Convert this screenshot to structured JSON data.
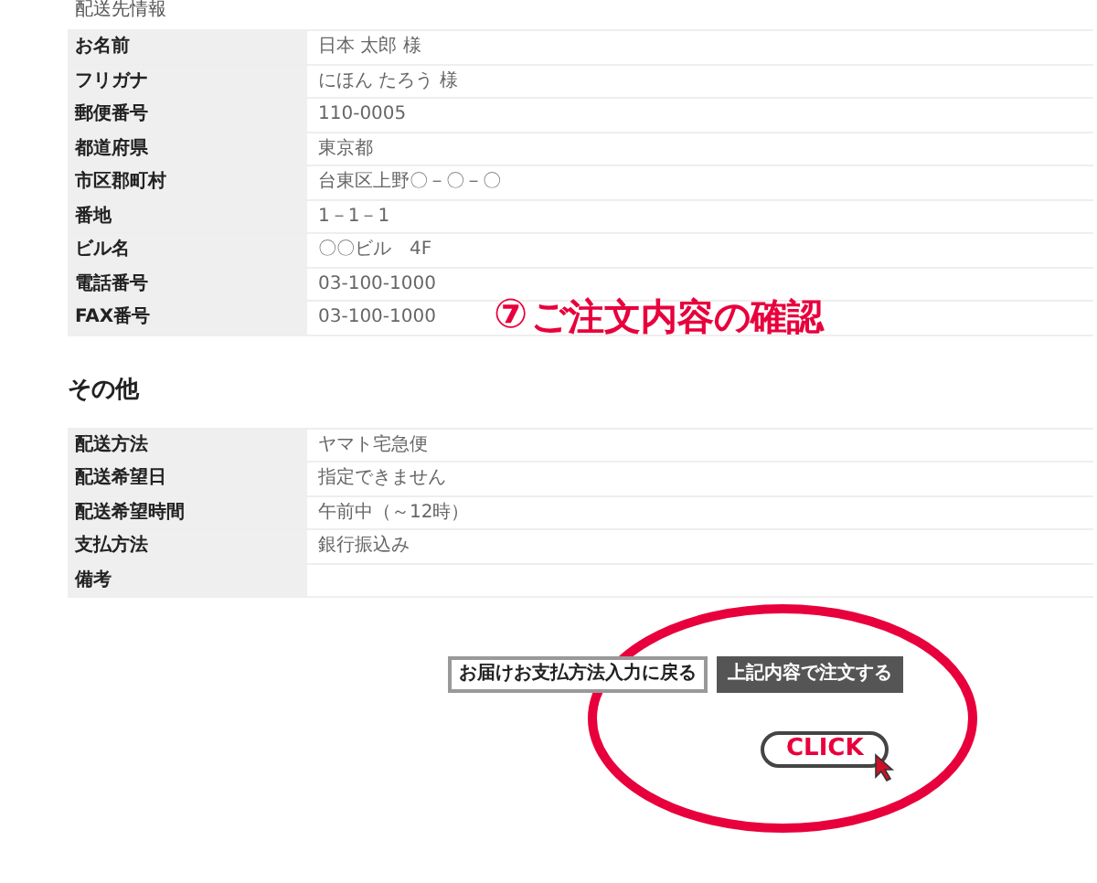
{
  "sections": [
    {
      "title": "配送先情報",
      "rows": [
        {
          "label": "お名前",
          "value": "日本 太郎 様"
        },
        {
          "label": "フリガナ",
          "value": "にほん たろう 様"
        },
        {
          "label": "郵便番号",
          "value": "110-0005"
        },
        {
          "label": "都道府県",
          "value": "東京都"
        },
        {
          "label": "市区郡町村",
          "value": "台東区上野〇－〇－〇"
        },
        {
          "label": "番地",
          "value": "1－1－1"
        },
        {
          "label": "ビル名",
          "value": "〇〇ビル　4F"
        },
        {
          "label": "電話番号",
          "value": "03-100-1000"
        },
        {
          "label": "FAX番号",
          "value": "03-100-1000"
        }
      ]
    },
    {
      "title": "その他",
      "rows": [
        {
          "label": "配送方法",
          "value": "ヤマト宅急便"
        },
        {
          "label": "配送希望日",
          "value": "指定できません"
        },
        {
          "label": "配送希望時間",
          "value": "午前中（～12時）"
        },
        {
          "label": "支払方法",
          "value": "銀行振込み"
        },
        {
          "label": "備考"
        }
      ]
    }
  ],
  "buttons": [
    {
      "label": "お届けお支払方法入力に戻る",
      "kind": "secondary"
    },
    {
      "label": "上記内容で注文する",
      "kind": "primary"
    }
  ],
  "annotation": {
    "step": "⑦",
    "text": "ご注文内容の確認",
    "callout": "CLICK"
  }
}
